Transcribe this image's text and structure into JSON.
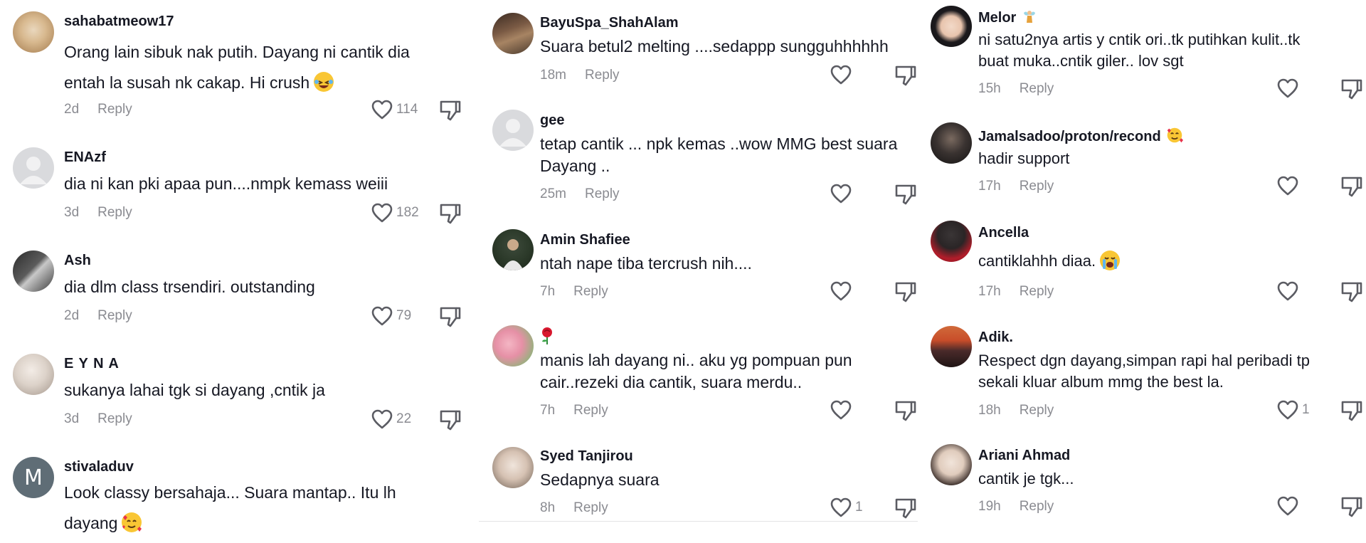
{
  "reply_label": "Reply",
  "columns": [
    {
      "comments": [
        {
          "username": "sahabatmeow17",
          "lines": [
            "Orang lain sibuk nak putih. Dayang ni cantik dia",
            "entah la susah nk cakap. Hi crush"
          ],
          "emoji": "laughing-emoji",
          "time": "2d",
          "likes": "114"
        },
        {
          "username": "ENAzf",
          "lines": [
            "dia ni kan pki apaa pun....nmpk kemass weiii"
          ],
          "time": "3d",
          "likes": "182"
        },
        {
          "username": "Ash",
          "lines": [
            "dia dlm class trsendiri. outstanding"
          ],
          "time": "2d",
          "likes": "79"
        },
        {
          "username": "E Y N A",
          "lines": [
            "sukanya lahai tgk si dayang ,cntik ja"
          ],
          "time": "3d",
          "likes": "22"
        },
        {
          "username": "stivaladuv",
          "avatar_letter": "M",
          "lines": [
            "Look classy bersahaja... Suara mantap.. Itu lh",
            "dayang"
          ],
          "emoji": "smiling-hearts-emoji"
        }
      ]
    },
    {
      "comments": [
        {
          "username": "BayuSpa_ShahAlam",
          "lines": [
            "Suara betul2 melting ....sedappp sungguhhhhhh"
          ],
          "time": "18m",
          "likes": ""
        },
        {
          "username": "gee",
          "lines": [
            "tetap cantik ... npk kemas ..wow MMG best suara",
            "Dayang .."
          ],
          "time": "25m",
          "likes": ""
        },
        {
          "username": "Amin Shafiee",
          "lines": [
            "ntah nape tiba tercrush nih...."
          ],
          "time": "7h",
          "likes": ""
        },
        {
          "username": "",
          "username_icon": "rose-emoji",
          "lines": [
            "manis lah dayang ni.. aku yg pompuan pun",
            "cair..rezeki dia cantik, suara merdu.."
          ],
          "time": "7h",
          "likes": ""
        },
        {
          "username": "Syed Tanjirou",
          "lines": [
            "Sedapnya suara"
          ],
          "time": "8h",
          "likes": "1"
        }
      ]
    },
    {
      "comments": [
        {
          "username": "Melor",
          "username_icon": "fairy-emoji",
          "lines": [
            "ni satu2nya artis y cntik ori..tk putihkan kulit..tk",
            "buat muka..cntik giler.. lov sgt"
          ],
          "time": "15h",
          "likes": ""
        },
        {
          "username": "Jamalsadoo/proton/recond",
          "username_icon": "smiling-hearts-emoji",
          "lines": [
            "hadir support"
          ],
          "time": "17h",
          "likes": ""
        },
        {
          "username": "Ancella",
          "lines": [
            "cantiklahhh diaa."
          ],
          "emoji": "crying-emoji",
          "time": "17h",
          "likes": ""
        },
        {
          "username": "Adik.",
          "lines": [
            "Respect dgn dayang,simpan rapi hal peribadi tp",
            "sekali kluar album mmg the best la."
          ],
          "time": "18h",
          "likes": "1"
        },
        {
          "username": "Ariani Ahmad",
          "lines": [
            "cantik je tgk..."
          ],
          "time": "19h",
          "likes": ""
        }
      ]
    }
  ],
  "colors": {
    "text": "#161823",
    "meta": "#8a8b91",
    "icon": "#5b5c63",
    "divider": "#e3e3e4"
  }
}
